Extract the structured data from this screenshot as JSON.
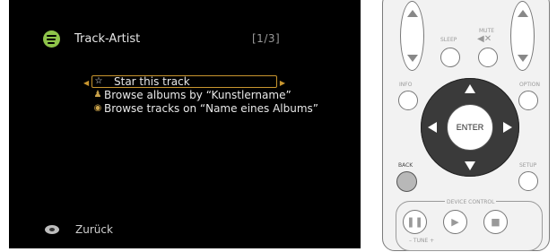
{
  "screen": {
    "title": "Track-Artist",
    "page_indicator": "[1/3]",
    "menu": [
      {
        "icon": "star-outline-icon",
        "glyph": "☆",
        "label": "Star this track",
        "selected": true
      },
      {
        "icon": "person-icon",
        "glyph": "♟",
        "label": "Browse albums by “Kunstlername”",
        "selected": false
      },
      {
        "icon": "disc-icon",
        "glyph": "◉",
        "label": "Browse tracks on “Name eines Albums”",
        "selected": false
      }
    ],
    "footer": {
      "back_label": "Zurück"
    },
    "colors": {
      "selection": "#c9962f",
      "spotify": "#8ec44a"
    }
  },
  "remote": {
    "sleep": "SLEEP",
    "mute": "MUTE",
    "info": "INFO",
    "option": "OPTION",
    "enter": "ENTER",
    "back": "BACK",
    "setup": "SETUP",
    "device_control": "DEVICE CONTROL",
    "tune": "–  TUNE  +"
  }
}
